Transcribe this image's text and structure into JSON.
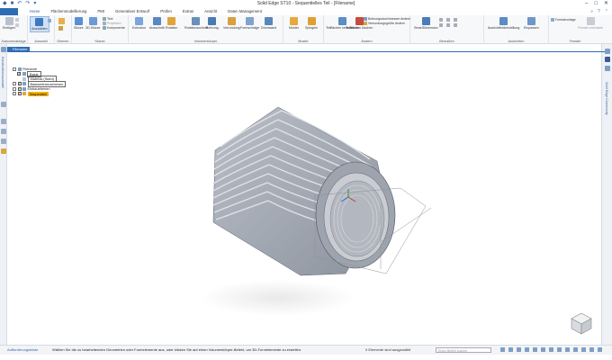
{
  "app": {
    "title": "Solid Edge ST10 - Sequentielles Teil - [Filename]"
  },
  "qat": {
    "icons": [
      "app-logo-icon",
      "save-icon",
      "undo-icon",
      "redo-icon",
      "customize-icon"
    ]
  },
  "window_controls": [
    "minimize",
    "maximize",
    "close"
  ],
  "tabs": [
    {
      "label": "Home",
      "active": true
    },
    {
      "label": "Flächenmodellierung"
    },
    {
      "label": "PMI"
    },
    {
      "label": "Generativer Entwurf"
    },
    {
      "label": "Prüfen"
    },
    {
      "label": "Extras"
    },
    {
      "label": "Ansicht"
    },
    {
      "label": "Daten Management"
    }
  ],
  "ribbon": {
    "groups": [
      {
        "name": "Zwischenablage",
        "buttons": [
          "Einfügen"
        ]
      },
      {
        "name": "Auswahl",
        "buttons": [
          "Auswählen"
        ]
      },
      {
        "name": "Ebenen",
        "buttons": []
      },
      {
        "name": "Skizze",
        "buttons": [
          "Skizze",
          "3D-Skizze"
        ],
        "small": [
          "Text",
          "Projektion",
          "Komponente"
        ]
      },
      {
        "name": "Volumenkörper",
        "buttons": [
          "Extrusion",
          "Ausschnitt",
          "Rotation",
          "Rotationsschnitt",
          "Bohrung",
          "Verrundung",
          "Formschräge",
          "Dünnwand"
        ]
      },
      {
        "name": "Muster",
        "buttons": [
          "Muster",
          "Spiegeln"
        ]
      },
      {
        "name": "Ändern",
        "buttons": [
          "Teilflächen verschieben",
          "Teilflächen löschen"
        ],
        "small": [
          "Bohrungsdurchmesser ändern",
          "Verrundungsgröße ändern"
        ]
      },
      {
        "name": "Bemaßen",
        "buttons": [
          "SmartDimension"
        ]
      },
      {
        "name": "Ausrichten",
        "buttons": [
          "Ausrichtfeldverdrillung",
          "Einpassen"
        ]
      },
      {
        "name": "Fenster",
        "buttons": [
          "Formatvorlage",
          "Fenster wechseln"
        ]
      }
    ]
  },
  "document": {
    "tab": "Filename"
  },
  "side_panels": {
    "left": "Konstruktionsauswahl",
    "right": "Solid Edge Community"
  },
  "tree": {
    "items": [
      {
        "label": "Filename",
        "level": 0,
        "kind": "part",
        "selected": true
      },
      {
        "label": "Basis",
        "level": 1,
        "kind": "folder",
        "checked": true,
        "selected": true
      },
      {
        "label": "Material (Stahl)",
        "level": 2,
        "kind": "material"
      },
      {
        "label": "Basisreferenzebenen",
        "level": 1,
        "kind": "folder",
        "checked": true,
        "selected": true
      },
      {
        "label": "Einbauebenen",
        "level": 1,
        "kind": "folder",
        "checked": true
      },
      {
        "label": "Sequentiell",
        "level": 1,
        "kind": "folder",
        "highlighted": true
      }
    ]
  },
  "status": {
    "prompt_label": "Aufforderungsleiste",
    "prompt": "Wählen Sie die zu bearbeitenden Geometrien oder Formelemente aus, oder klicken Sie auf einen Volumenkörper-Befehl, um 3D-Formelemente zu erstellen.",
    "selection_count": "0 Elemente sind ausgewählt",
    "search_placeholder": "Einen Befehl suchen"
  },
  "colors": {
    "accent": "#2e6db4",
    "highlight": "#f4b400",
    "model_fill": "#9aa0ab"
  }
}
